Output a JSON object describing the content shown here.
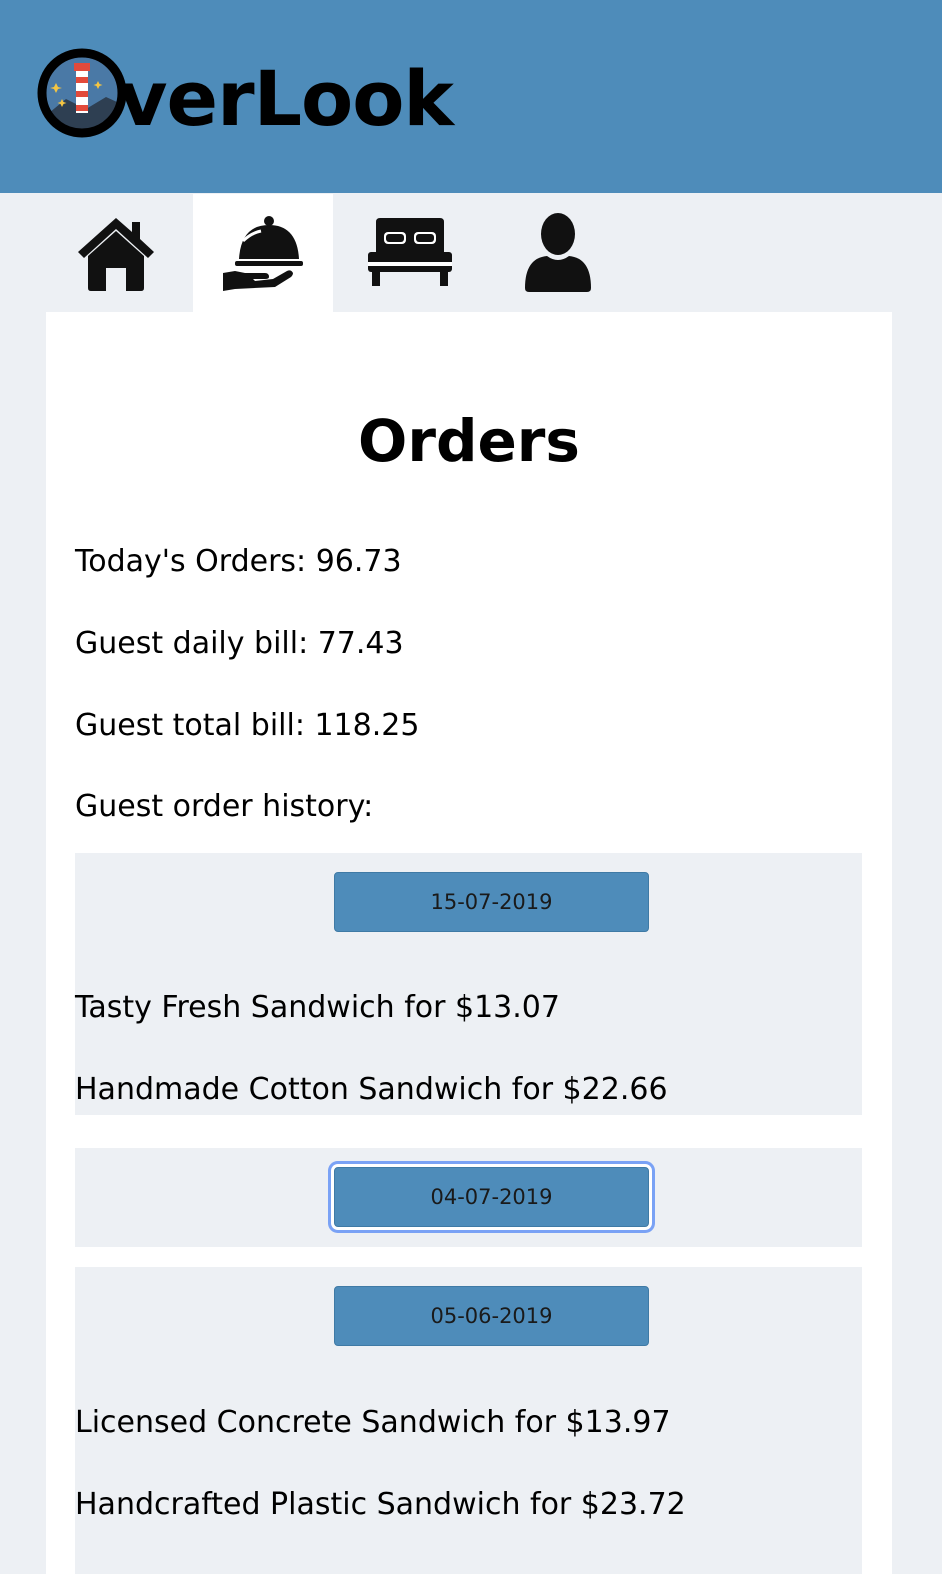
{
  "header": {
    "logo_text": "verLook",
    "logo_icon": "lighthouse-icon",
    "bg_color": "#4e8cba"
  },
  "nav": {
    "tabs": [
      {
        "icon": "home-icon",
        "active": false
      },
      {
        "icon": "room-service-icon",
        "active": true
      },
      {
        "icon": "bed-icon",
        "active": false
      },
      {
        "icon": "user-icon",
        "active": false
      }
    ]
  },
  "main": {
    "title": "Orders",
    "todays_orders": "Today's Orders: 96.73",
    "guest_daily_bill": "Guest daily bill: 77.43",
    "guest_total_bill": "Guest total bill: 118.25",
    "history_label": "Guest order history:",
    "history": [
      {
        "date": "15-07-2019",
        "items": [
          "Tasty Fresh Sandwich for $13.07",
          "Handmade Cotton Sandwich for $22.66"
        ]
      },
      {
        "date": "04-07-2019",
        "items": []
      },
      {
        "date": "05-06-2019",
        "items": [
          "Licensed Concrete Sandwich for $13.97",
          "Handcrafted Plastic Sandwich for $23.72"
        ]
      }
    ]
  },
  "colors": {
    "accent": "#4e8cba",
    "page_bg": "#edf0f4",
    "panel_bg": "#ffffff",
    "focus_ring": "#7aa2f5"
  }
}
